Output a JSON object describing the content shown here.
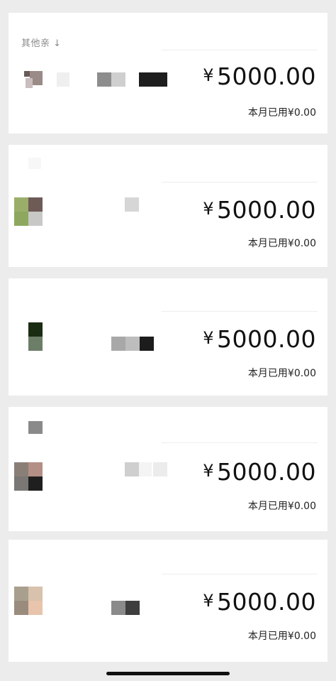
{
  "section": {
    "label": "其他亲 ↓"
  },
  "cards": [
    {
      "amount_symbol": "¥",
      "amount": "5000.00",
      "used_label": "本月已用",
      "used_value": "¥0.00"
    },
    {
      "amount_symbol": "¥",
      "amount": "5000.00",
      "used_label": "本月已用",
      "used_value": "¥0.00"
    },
    {
      "amount_symbol": "¥",
      "amount": "5000.00",
      "used_label": "本月已用",
      "used_value": "¥0.00"
    },
    {
      "amount_symbol": "¥",
      "amount": "5000.00",
      "used_label": "本月已用",
      "used_value": "¥0.00"
    },
    {
      "amount_symbol": "¥",
      "amount": "5000.00",
      "used_label": "本月已用",
      "used_value": "¥0.00"
    }
  ]
}
